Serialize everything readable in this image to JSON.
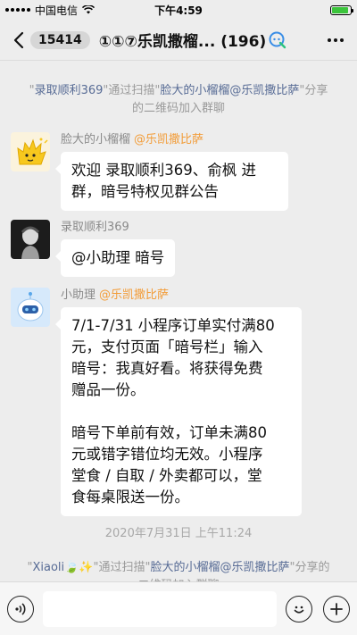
{
  "status_bar": {
    "carrier": "中国电信",
    "time": "下午4:59"
  },
  "nav": {
    "unread_count": "15414",
    "title": "①①⑦乐凯撒榴... (196)"
  },
  "chat": {
    "top_system": {
      "quote1": "\"",
      "name1": "录取顺利369",
      "mid": "\"通过扫描\"",
      "name2": "脸大的小榴榴@乐凯撒比萨",
      "end": "\"分享的二维码加入群聊"
    },
    "messages": [
      {
        "sender": "脸大的小榴榴",
        "tag": "@乐凯撒比萨",
        "text": "欢迎 录取顺利369、俞枫 进\n群，暗号特权见群公告"
      },
      {
        "sender": "录取顺利369",
        "tag": "",
        "text": "@小助理 暗号"
      },
      {
        "sender": "小助理",
        "tag": "@乐凯撒比萨",
        "text": "7/1-7/31 小程序订单实付满80\n元，支付页面「暗号栏」输入\n暗号：我真好看。将获得免费\n赠品一份。\n\n暗号下单前有效，订单未满80\n元或错字错位均无效。小程序\n堂食 / 自取 / 外卖都可以，堂\n食每桌限送一份。"
      }
    ],
    "timestamp": "2020年7月31日 上午11:24",
    "bottom_system": {
      "quote1": "\"",
      "name1": "Xiaoli🍃✨",
      "mid": "\"通过扫描\"",
      "name2": "脸大的小榴榴@乐凯撒比萨",
      "end": "\"分享的二维码加入群聊"
    }
  },
  "input_bar": {
    "value": ""
  }
}
